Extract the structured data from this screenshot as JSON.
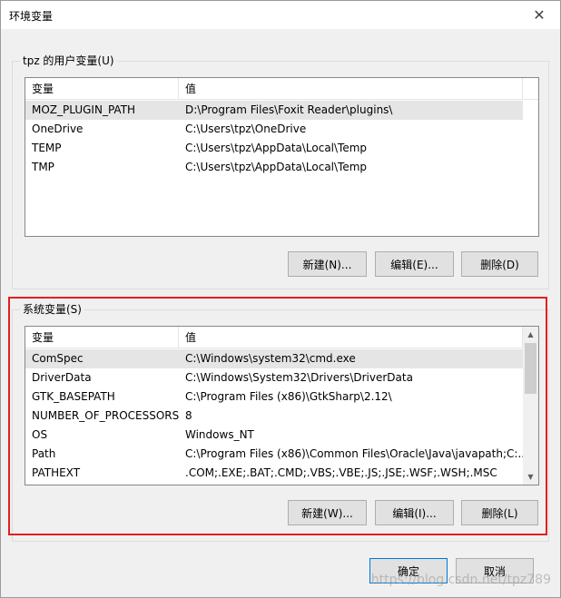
{
  "window": {
    "title": "环境变量",
    "close_glyph": "✕"
  },
  "user_group": {
    "label": "tpz 的用户变量(U)",
    "columns": [
      "变量",
      "值"
    ],
    "rows": [
      {
        "name": "MOZ_PLUGIN_PATH",
        "value": "D:\\Program Files\\Foxit Reader\\plugins\\"
      },
      {
        "name": "OneDrive",
        "value": "C:\\Users\\tpz\\OneDrive"
      },
      {
        "name": "TEMP",
        "value": "C:\\Users\\tpz\\AppData\\Local\\Temp"
      },
      {
        "name": "TMP",
        "value": "C:\\Users\\tpz\\AppData\\Local\\Temp"
      }
    ],
    "buttons": {
      "new": "新建(N)...",
      "edit": "编辑(E)...",
      "delete": "删除(D)"
    }
  },
  "system_group": {
    "label": "系统变量(S)",
    "columns": [
      "变量",
      "值"
    ],
    "rows": [
      {
        "name": "ComSpec",
        "value": "C:\\Windows\\system32\\cmd.exe"
      },
      {
        "name": "DriverData",
        "value": "C:\\Windows\\System32\\Drivers\\DriverData"
      },
      {
        "name": "GTK_BASEPATH",
        "value": "C:\\Program Files (x86)\\GtkSharp\\2.12\\"
      },
      {
        "name": "NUMBER_OF_PROCESSORS",
        "value": "8"
      },
      {
        "name": "OS",
        "value": "Windows_NT"
      },
      {
        "name": "Path",
        "value": "C:\\Program Files (x86)\\Common Files\\Oracle\\Java\\javapath;C:..."
      },
      {
        "name": "PATHEXT",
        "value": ".COM;.EXE;.BAT;.CMD;.VBS;.VBE;.JS;.JSE;.WSF;.WSH;.MSC"
      }
    ],
    "buttons": {
      "new": "新建(W)...",
      "edit": "编辑(I)...",
      "delete": "删除(L)"
    }
  },
  "footer": {
    "ok": "确定",
    "cancel": "取消"
  },
  "watermark": "https://blog.csdn.net/tpz789",
  "colors": {
    "highlight": "#e02020",
    "selection": "#e5e5e5",
    "default_border": "#0078d7"
  }
}
